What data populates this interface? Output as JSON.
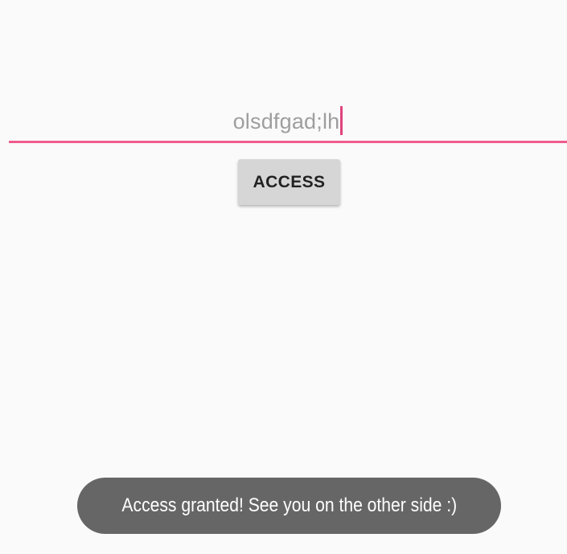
{
  "form": {
    "input_value": "olsdfgad;lh",
    "button_label": "ACCESS"
  },
  "toast": {
    "message": "Access granted! See you on the other side :)"
  },
  "colors": {
    "background": "#fafafa",
    "accent": "#ef5b8f",
    "button": "#d6d6d6",
    "toast": "#666666"
  }
}
